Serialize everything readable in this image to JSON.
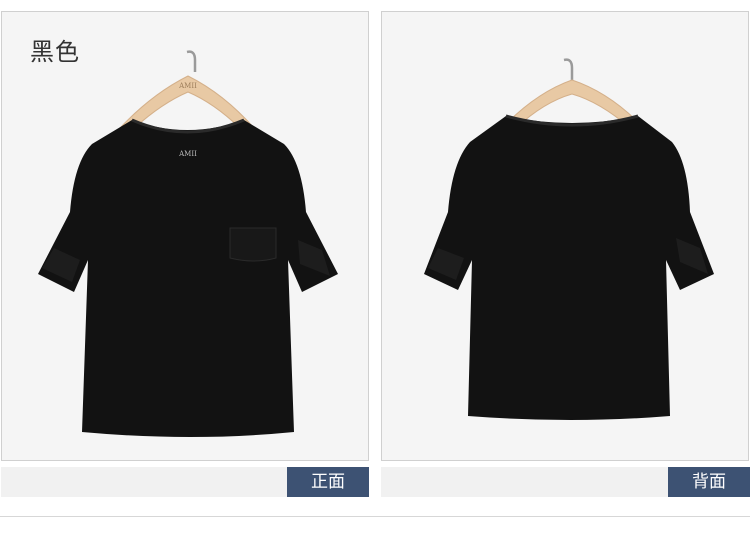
{
  "color_name": "黑色",
  "views": {
    "front": "正面",
    "back": "背面"
  },
  "hanger_brand": "AMII",
  "neck_label_brand": "AMII",
  "colors": {
    "tag_bg": "#3d5273",
    "shirt": "#121212",
    "hanger": "#e8c9a4",
    "panel_bg": "#f5f5f5"
  }
}
